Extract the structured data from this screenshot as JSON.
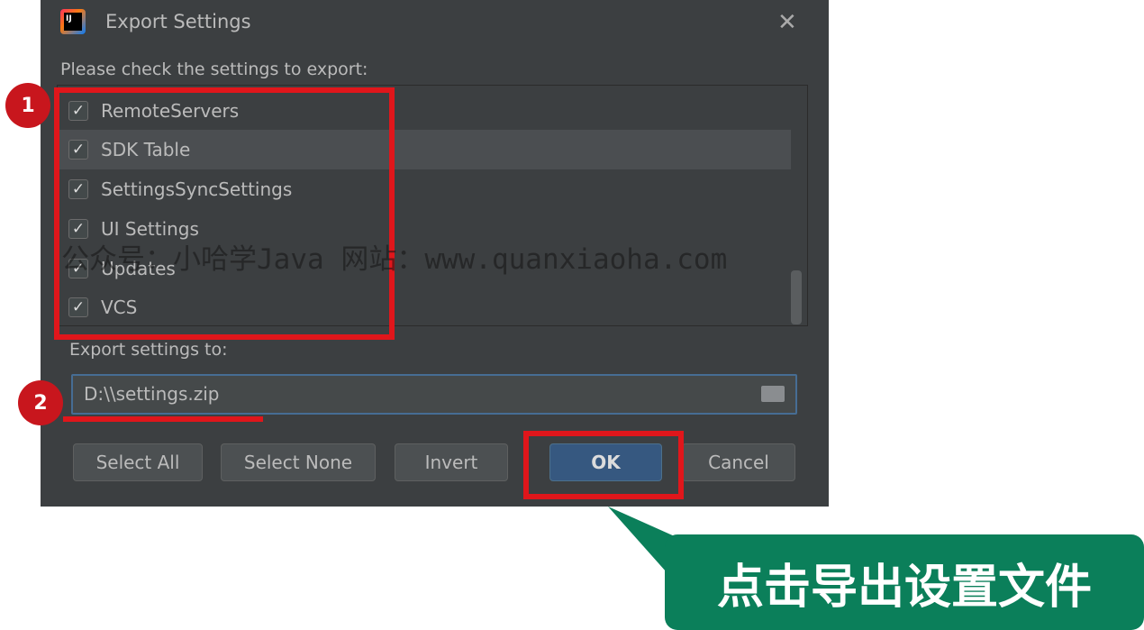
{
  "dialog": {
    "title": "Export Settings",
    "prompt": "Please check the settings to export:",
    "items": [
      {
        "label": "RemoteServers",
        "checked": true
      },
      {
        "label": "SDK Table",
        "checked": true,
        "selected": true
      },
      {
        "label": "SettingsSyncSettings",
        "checked": true
      },
      {
        "label": "UI Settings",
        "checked": true
      },
      {
        "label": "Updates",
        "checked": true
      },
      {
        "label": "VCS",
        "checked": true
      }
    ],
    "export_label": "Export settings to:",
    "export_path": "D:\\\\settings.zip",
    "buttons": {
      "select_all": "Select All",
      "select_none": "Select None",
      "invert": "Invert",
      "ok": "OK",
      "cancel": "Cancel"
    },
    "check_glyph": "✓",
    "close_glyph": "✕",
    "logo_text": "IJ"
  },
  "annotations": {
    "marker1": "1",
    "marker2": "2",
    "callout": "点击导出设置文件",
    "watermark": "公众号：小哈学Java 网站：www.quanxiaoha.com",
    "highlight_color": "#e0161b",
    "callout_color": "#0b7f5a"
  }
}
